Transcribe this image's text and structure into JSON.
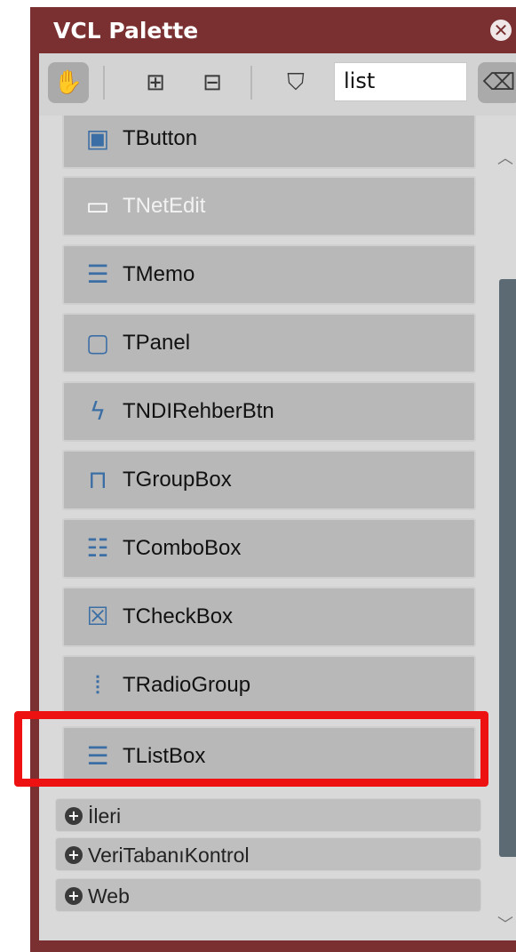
{
  "window": {
    "title": "VCL Palette",
    "close_icon": "close-icon"
  },
  "toolbar": {
    "buttons": [
      {
        "name": "hand",
        "icon": "hand-icon",
        "glyph": "✋"
      },
      {
        "name": "expand",
        "icon": "expand-tree-icon",
        "glyph": "⊞"
      },
      {
        "name": "collapse",
        "icon": "collapse-tree-icon",
        "glyph": "⊟"
      },
      {
        "name": "filter",
        "icon": "filter-icon",
        "glyph": "⛉"
      },
      {
        "name": "clear",
        "icon": "clear-search-icon",
        "glyph": "⌫"
      }
    ],
    "search_value": "list"
  },
  "items": [
    {
      "label": "TButton",
      "icon": "button-icon",
      "glyph": "▣",
      "disabled": false
    },
    {
      "label": "TNetEdit",
      "icon": "edit-icon",
      "glyph": "▭",
      "disabled": true
    },
    {
      "label": "TMemo",
      "icon": "memo-icon",
      "glyph": "☰",
      "disabled": false
    },
    {
      "label": "TPanel",
      "icon": "panel-icon",
      "glyph": "▢",
      "disabled": false
    },
    {
      "label": "TNDIRehberBtn",
      "icon": "lightning-icon",
      "glyph": "ϟ",
      "disabled": false
    },
    {
      "label": "TGroupBox",
      "icon": "groupbox-icon",
      "glyph": "⊓",
      "disabled": false
    },
    {
      "label": "TComboBox",
      "icon": "combobox-icon",
      "glyph": "☷",
      "disabled": false
    },
    {
      "label": "TCheckBox",
      "icon": "checkbox-icon",
      "glyph": "☒",
      "disabled": false
    },
    {
      "label": "TRadioGroup",
      "icon": "radiogroup-icon",
      "glyph": "⦙",
      "disabled": false
    },
    {
      "label": "TListBox",
      "icon": "listbox-icon",
      "glyph": "☰",
      "disabled": false,
      "highlighted": true
    }
  ],
  "groups": [
    {
      "label": "İleri",
      "icon": "plus-icon"
    },
    {
      "label": "VeriTabanıKontrol",
      "icon": "plus-icon"
    },
    {
      "label": "Web",
      "icon": "plus-icon"
    }
  ],
  "scrollbar": {
    "up_glyph": "︿",
    "down_glyph": "﹀"
  }
}
